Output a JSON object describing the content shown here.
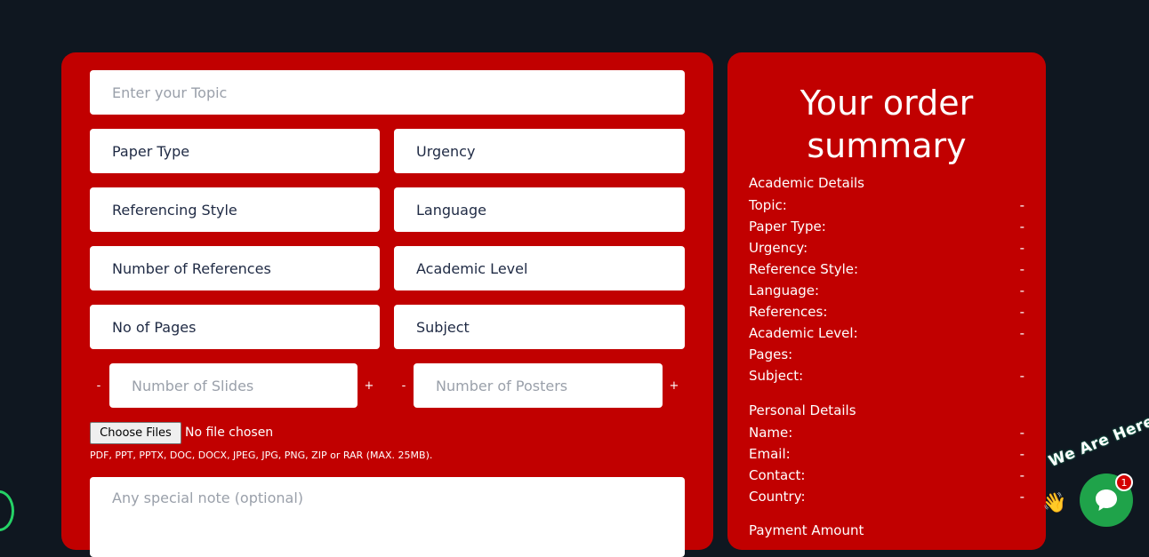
{
  "form": {
    "topic_placeholder": "Enter your Topic",
    "paper_type": "Paper Type",
    "urgency": "Urgency",
    "referencing_style": "Referencing Style",
    "language": "Language",
    "number_of_references": "Number of References",
    "academic_level": "Academic Level",
    "no_of_pages": "No of Pages",
    "subject": "Subject",
    "slides": {
      "placeholder": "Number of Slides",
      "minus": "-",
      "plus": "+"
    },
    "posters": {
      "placeholder": "Number of Posters",
      "minus": "-",
      "plus": "+"
    },
    "file": {
      "button_label": "Choose Files",
      "status": "No file chosen",
      "hint": "PDF, PPT, PPTX, DOC, DOCX, JPEG, JPG, PNG, ZIP or RAR (MAX. 25MB)."
    },
    "note_placeholder": "Any special note (optional)"
  },
  "summary": {
    "title_line1": "Your order",
    "title_line2": "summary",
    "academic_heading": "Academic Details",
    "academic_rows": [
      {
        "label": "Topic:",
        "value": "-"
      },
      {
        "label": "Paper Type:",
        "value": "-"
      },
      {
        "label": "Urgency:",
        "value": "-"
      },
      {
        "label": "Reference Style:",
        "value": "-"
      },
      {
        "label": "Language:",
        "value": "-"
      },
      {
        "label": "References:",
        "value": "-"
      },
      {
        "label": "Academic Level:",
        "value": "-"
      },
      {
        "label": "Pages:",
        "value": ""
      },
      {
        "label": "Subject:",
        "value": "-"
      }
    ],
    "personal_heading": "Personal Details",
    "personal_rows": [
      {
        "label": "Name:",
        "value": "-"
      },
      {
        "label": "Email:",
        "value": "-"
      },
      {
        "label": "Contact:",
        "value": "-"
      },
      {
        "label": "Country:",
        "value": "-"
      }
    ],
    "payment_heading": "Payment Amount"
  },
  "chat": {
    "tagline": "We Are Here!",
    "badge_count": "1",
    "hand_icon": "waving-hand-icon",
    "bubble_icon": "chat-bubble-icon"
  },
  "colors": {
    "background": "#0f1720",
    "card": "#c10000",
    "chat_green": "#1fa34a"
  }
}
